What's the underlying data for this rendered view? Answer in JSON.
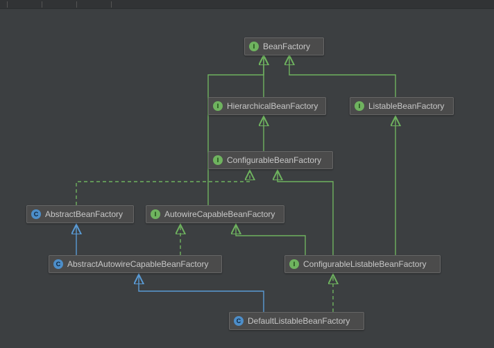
{
  "diagram": {
    "nodes": {
      "beanFactory": {
        "label": "BeanFactory",
        "kind": "interface",
        "badge": "I"
      },
      "hierarchicalBeanFactory": {
        "label": "HierarchicalBeanFactory",
        "kind": "interface",
        "badge": "I"
      },
      "listableBeanFactory": {
        "label": "ListableBeanFactory",
        "kind": "interface",
        "badge": "I"
      },
      "configurableBeanFactory": {
        "label": "ConfigurableBeanFactory",
        "kind": "interface",
        "badge": "I"
      },
      "abstractBeanFactory": {
        "label": "AbstractBeanFactory",
        "kind": "class",
        "badge": "C"
      },
      "autowireCapableBeanFactory": {
        "label": "AutowireCapableBeanFactory",
        "kind": "interface",
        "badge": "I"
      },
      "abstractAutowireCapableBeanFactory": {
        "label": "AbstractAutowireCapableBeanFactory",
        "kind": "class",
        "badge": "C"
      },
      "configurableListableBeanFactory": {
        "label": "ConfigurableListableBeanFactory",
        "kind": "interface",
        "badge": "I"
      },
      "defaultListableBeanFactory": {
        "label": "DefaultListableBeanFactory",
        "kind": "class",
        "badge": "C"
      }
    },
    "edges": [
      {
        "from": "hierarchicalBeanFactory",
        "to": "beanFactory",
        "style": "solid",
        "color": "green"
      },
      {
        "from": "listableBeanFactory",
        "to": "beanFactory",
        "style": "solid",
        "color": "green"
      },
      {
        "from": "configurableBeanFactory",
        "to": "hierarchicalBeanFactory",
        "style": "solid",
        "color": "green"
      },
      {
        "from": "autowireCapableBeanFactory",
        "to": "beanFactory",
        "style": "solid",
        "color": "green"
      },
      {
        "from": "abstractBeanFactory",
        "to": "configurableBeanFactory",
        "style": "dashed",
        "color": "green"
      },
      {
        "from": "abstractAutowireCapableBeanFactory",
        "to": "abstractBeanFactory",
        "style": "solid",
        "color": "blue"
      },
      {
        "from": "abstractAutowireCapableBeanFactory",
        "to": "autowireCapableBeanFactory",
        "style": "dashed",
        "color": "green"
      },
      {
        "from": "configurableListableBeanFactory",
        "to": "autowireCapableBeanFactory",
        "style": "solid",
        "color": "green"
      },
      {
        "from": "configurableListableBeanFactory",
        "to": "configurableBeanFactory",
        "style": "solid",
        "color": "green"
      },
      {
        "from": "configurableListableBeanFactory",
        "to": "listableBeanFactory",
        "style": "solid",
        "color": "green"
      },
      {
        "from": "defaultListableBeanFactory",
        "to": "abstractAutowireCapableBeanFactory",
        "style": "solid",
        "color": "blue"
      },
      {
        "from": "defaultListableBeanFactory",
        "to": "configurableListableBeanFactory",
        "style": "dashed",
        "color": "green"
      }
    ],
    "colors": {
      "green_line": "#6fb35f",
      "blue_line": "#5a9bd5"
    }
  }
}
